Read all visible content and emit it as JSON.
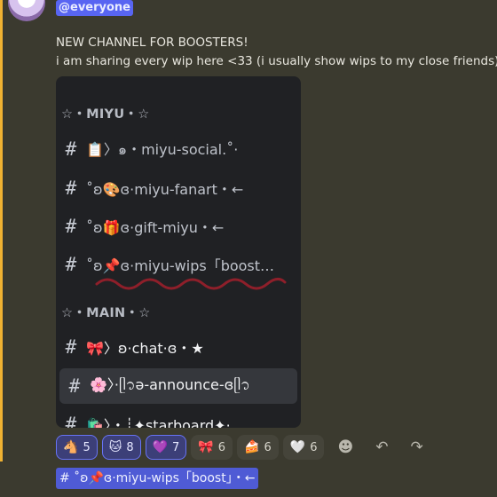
{
  "header": {
    "mention": "@everyone"
  },
  "message": {
    "line1": "NEW CHANNEL FOR BOOSTERS!",
    "line2": "i am sharing every wip here <33 (i usually show wips to my close friends)"
  },
  "embed": {
    "categories": [
      {
        "label": "☆・MIYU・☆"
      },
      {
        "label": "☆・MAIN・☆"
      }
    ],
    "channels": [
      {
        "hash": "#",
        "name": "📋〉๑・miyu-social.˚·"
      },
      {
        "hash": "#",
        "name": "˚ʚ🎨ɞ·miyu-fanart・←"
      },
      {
        "hash": "#",
        "name": "˚ʚ🎁ɞ·gift-miyu・←"
      },
      {
        "hash": "#",
        "name": "˚ʚ📌ɞ·miyu-wips「boost…"
      },
      {
        "hash": "#",
        "name": "🎀〉ʚ·chat·ɞ・★"
      },
      {
        "hash": "#",
        "name": "🌸〉·ᥫ᭡ә-announce-ɞᥫ᭡"
      },
      {
        "hash": "#",
        "name": "🛍️〉・┊✦starboard✦·…"
      }
    ]
  },
  "reactions": [
    {
      "emoji": "🐴",
      "count": "5",
      "active": true
    },
    {
      "emoji": "🐱",
      "count": "8",
      "active": true
    },
    {
      "emoji": "💜",
      "count": "7",
      "active": true
    },
    {
      "emoji": "🎀",
      "count": "6",
      "active": false
    },
    {
      "emoji": "🍰",
      "count": "6",
      "active": false
    },
    {
      "emoji": "🤍",
      "count": "6",
      "active": false
    }
  ],
  "actions": {
    "add_reaction_icon": "☻",
    "reply_icon": "↶",
    "forward_icon": "↷"
  },
  "bottom": {
    "channel_mention": "# ˚ʚ📌ɞ·miyu-wips「boost」・←"
  },
  "colors": {
    "background": "#3b3a2f",
    "accent_bar": "#f0b232",
    "mention": "#5865f2",
    "embed_bg": "#202124"
  }
}
